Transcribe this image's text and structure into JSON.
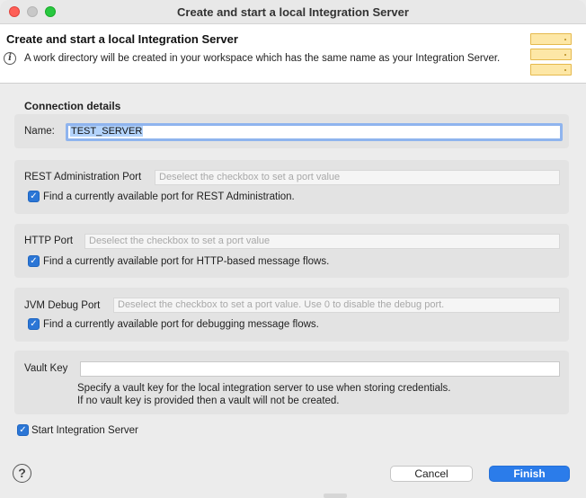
{
  "window": {
    "title": "Create and start a local Integration Server"
  },
  "header": {
    "title": "Create and start a local Integration Server",
    "description": "A work directory will be created in your workspace which has the same name as your Integration Server.",
    "info_icon": "i"
  },
  "connection": {
    "section_title": "Connection details",
    "name_label": "Name:",
    "name_value": "TEST_SERVER"
  },
  "rest_port": {
    "label": "REST Administration Port",
    "placeholder": "Deselect the checkbox to set a port value",
    "checkbox_label": "Find a currently available port for REST Administration.",
    "checked": true
  },
  "http_port": {
    "label": "HTTP Port",
    "placeholder": "Deselect the checkbox to set a port value",
    "checkbox_label": "Find a currently available port for HTTP-based message flows.",
    "checked": true
  },
  "jvm_port": {
    "label": "JVM Debug Port",
    "placeholder": "Deselect the checkbox to set a port value. Use 0 to disable the debug port.",
    "checkbox_label": "Find a currently available port for debugging message flows.",
    "checked": true
  },
  "vault": {
    "label": "Vault Key",
    "value": "",
    "hint_line1": "Specify a vault key for the local integration server to use when storing credentials.",
    "hint_line2": "If no vault key is provided then a vault will not be created."
  },
  "start_server": {
    "label": "Start Integration Server",
    "checked": true
  },
  "footer": {
    "help_icon": "?",
    "cancel_label": "Cancel",
    "finish_label": "Finish"
  },
  "icons": {
    "checkmark": "✓",
    "server_graphic": "server-stack-icon"
  },
  "colors": {
    "accent": "#2b7cea",
    "checkbox": "#2b76d6",
    "selection": "#b3d3fb",
    "server_graphic": "#fde7a6"
  }
}
